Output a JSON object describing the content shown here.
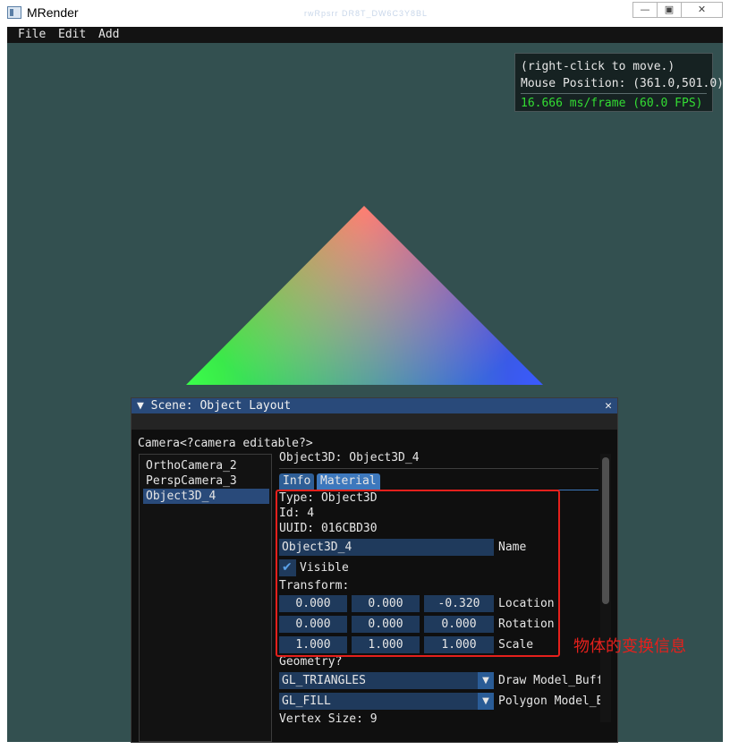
{
  "window": {
    "title": "MRender",
    "title_blur": "rwRpsrr  DR8T_DW6C3Y8BL",
    "minimize_glyph": "—",
    "maximize_glyph": "▣",
    "close_glyph": "✕",
    "bottom_blur": "▁ ▂▁ ▁▁ ▂ ▁"
  },
  "menu": {
    "file": "File",
    "edit": "Edit",
    "add": "Add"
  },
  "overlay": {
    "hint": "(right-click to move.)",
    "mouse": "Mouse Position: (361.0,501.0)",
    "fps": "16.666 ms/frame (60.0 FPS)"
  },
  "scene": {
    "title": "▼ Scene: Object Layout",
    "close": "✕",
    "camera_line": "Camera<?camera editable?>",
    "tree": [
      "OrthoCamera_2",
      "PerspCamera_3",
      "Object3D_4"
    ],
    "header": "Object3D: Object3D_4",
    "tabs": {
      "info": "Info",
      "material": "Material"
    },
    "type": "Type: Object3D",
    "id": "Id: 4",
    "uuid": "UUID: 016CBD30",
    "name_value": "Object3D_4",
    "name_label": "Name",
    "visible_label": "Visible",
    "transform_label": "Transform:",
    "location": [
      "0.000",
      "0.000",
      "-0.320"
    ],
    "location_label": "Location",
    "rotation": [
      "0.000",
      "0.000",
      "0.000"
    ],
    "rotation_label": "Rotation",
    "scale": [
      "1.000",
      "1.000",
      "1.000"
    ],
    "scale_label": "Scale",
    "geometry_label": "Geometry?",
    "draw_mode_value": "GL_TRIANGLES",
    "draw_mode_label": "Draw Model_Buffe",
    "polygon_mode_value": "GL_FILL",
    "polygon_mode_label": "Polygon Model_Bu",
    "vertex_size": "Vertex Size: 9",
    "combo_arrow": "▼",
    "checkmark": "✔"
  },
  "annotation": "物体的变换信息",
  "colors": {
    "viewport_bg": "#335050",
    "highlight_red": "#e5201c",
    "fps_green": "#33dd33",
    "accent_blue": "#3d78bd"
  }
}
